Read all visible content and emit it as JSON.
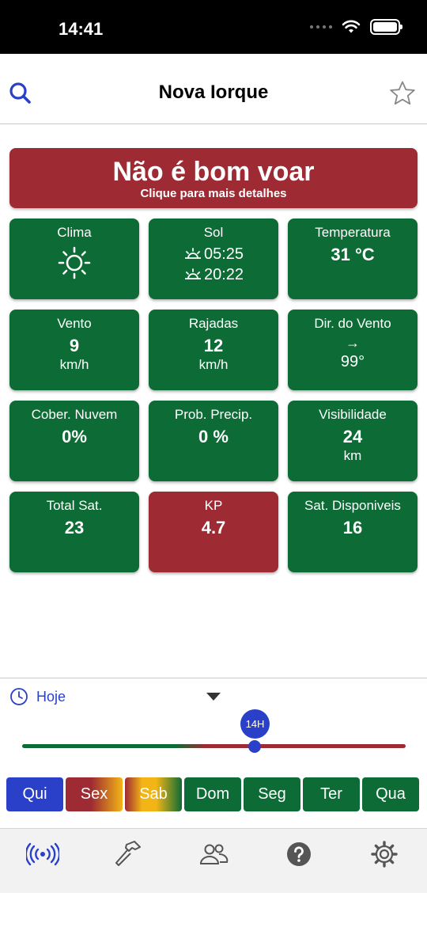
{
  "status_bar": {
    "time": "14:41"
  },
  "header": {
    "title": "Nova Iorque"
  },
  "alert": {
    "title": "Não é bom voar",
    "subtitle": "Clique para mais detalhes",
    "color": "#9e2a33"
  },
  "cards": {
    "clima": {
      "label": "Clima",
      "icon": "sun-icon"
    },
    "sol": {
      "label": "Sol",
      "sunrise": "05:25",
      "sunset": "20:22"
    },
    "temperatura": {
      "label": "Temperatura",
      "value": "31 °C"
    },
    "vento": {
      "label": "Vento",
      "value": "9",
      "unit": "km/h"
    },
    "rajadas": {
      "label": "Rajadas",
      "value": "12",
      "unit": "km/h"
    },
    "dir_vento": {
      "label": "Dir. do Vento",
      "arrow": "→",
      "value": "99°"
    },
    "nuvem": {
      "label": "Cober. Nuvem",
      "value": "0%"
    },
    "precip": {
      "label": "Prob. Precip.",
      "value": "0 %"
    },
    "visibilidade": {
      "label": "Visibilidade",
      "value": "24",
      "unit": "km"
    },
    "total_sat": {
      "label": "Total Sat.",
      "value": "23"
    },
    "kp": {
      "label": "KP",
      "value": "4.7"
    },
    "sat_disp": {
      "label": "Sat. Disponiveis",
      "value": "16"
    }
  },
  "colors": {
    "good": "#0d6b35",
    "bad": "#9e2a33",
    "accent": "#2a40c9"
  },
  "timeline": {
    "day_label": "Hoje",
    "hour_bubble": "14H"
  },
  "days": [
    {
      "label": "Qui",
      "style": "selected"
    },
    {
      "label": "Sex",
      "style": "mixed-red-orange"
    },
    {
      "label": "Sab",
      "style": "mixed-yellow-green"
    },
    {
      "label": "Dom",
      "style": "good"
    },
    {
      "label": "Seg",
      "style": "good"
    },
    {
      "label": "Ter",
      "style": "good"
    },
    {
      "label": "Qua",
      "style": "good"
    }
  ],
  "tabs": [
    {
      "icon": "broadcast-icon",
      "active": true
    },
    {
      "icon": "hammer-icon",
      "active": false
    },
    {
      "icon": "users-icon",
      "active": false
    },
    {
      "icon": "help-icon",
      "active": false
    },
    {
      "icon": "settings-icon",
      "active": false
    }
  ]
}
